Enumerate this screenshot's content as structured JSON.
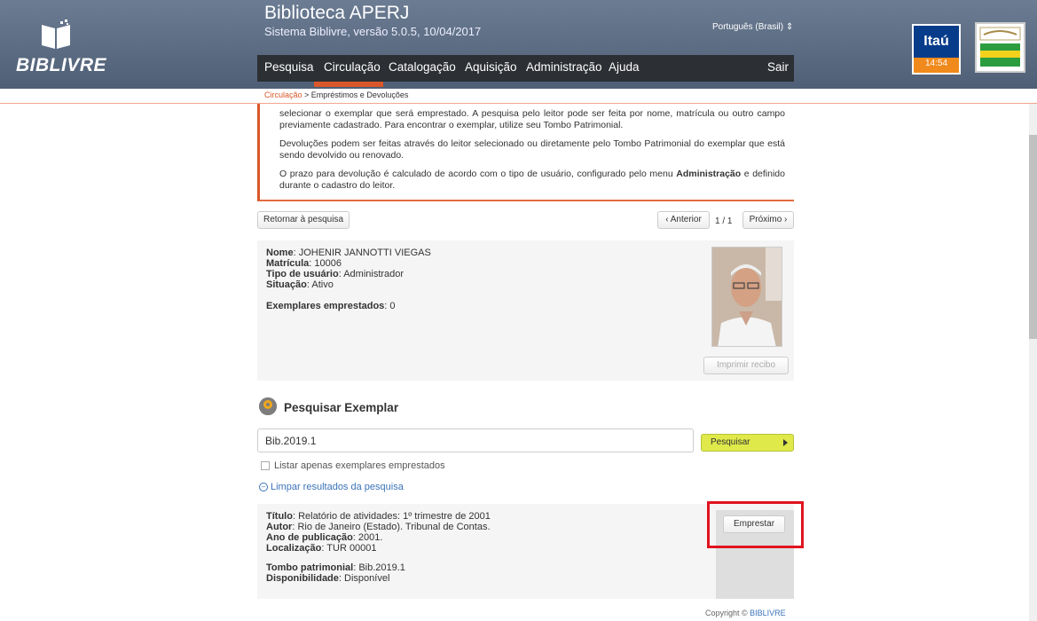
{
  "header": {
    "logo_text": "BIBLIVRE",
    "title": "Biblioteca APERJ",
    "subtitle": "Sistema Biblivre, versão 5.0.5, 10/04/2017",
    "language": "Português (Brasil)",
    "itau_label": "Itaú",
    "itau_time": "14:54",
    "badge_name": "brasil-cultura-badge"
  },
  "menu": {
    "items": [
      "Pesquisa",
      "Circulação",
      "Catalogação",
      "Aquisição",
      "Administração",
      "Ajuda"
    ],
    "logout": "Sair"
  },
  "breadcrumb": {
    "link": "Circulação",
    "separator": " > ",
    "current": "Empréstimos e Devoluções"
  },
  "info": {
    "p1": "selecionar o exemplar que será emprestado. A pesquisa pelo leitor pode ser feita por nome, matrícula ou outro campo previamente cadastrado. Para encontrar o exemplar, utilize seu Tombo Patrimonial.",
    "p2": "Devoluções podem ser feitas através do leitor selecionado ou diretamente pelo Tombo Patrimonial do exemplar que está sendo devolvido ou renovado.",
    "p3_a": "O prazo para devolução é calculado de acordo com o tipo de usuário, configurado pelo menu ",
    "p3_b": "Administração",
    "p3_c": " e definido durante o cadastro do leitor."
  },
  "nav": {
    "back": "Retornar à pesquisa",
    "prev": "‹ Anterior",
    "count": "1 / 1",
    "next": "Próximo ›"
  },
  "user": {
    "nome_label": "Nome",
    "nome": "JOHENIR JANNOTTI VIEGAS",
    "matricula_label": "Matrícula",
    "matricula": "10006",
    "tipo_label": "Tipo de usuário",
    "tipo": "Administrador",
    "situacao_label": "Situação",
    "situacao": "Ativo",
    "emprestados_label": "Exemplares emprestados",
    "emprestados": "0",
    "print_button": "Imprimir recibo"
  },
  "search": {
    "title": "Pesquisar Exemplar",
    "value": "Bib.2019.1",
    "button": "Pesquisar",
    "checkbox_label": "Listar apenas exemplares emprestados",
    "clear_link": "Limpar resultados da pesquisa"
  },
  "result": {
    "titulo_label": "Título",
    "titulo": "Relatório de atividades: 1º trimestre de 2001",
    "autor_label": "Autor",
    "autor": "Rio de Janeiro (Estado). Tribunal de Contas.",
    "ano_label": "Ano de publicação",
    "ano": "2001.",
    "local_label": "Localização",
    "local": "TUR 00001",
    "tombo_label": "Tombo patrimonial",
    "tombo": "Bib.2019.1",
    "disp_label": "Disponibilidade",
    "disp": "Disponível",
    "button": "Emprestar"
  },
  "footer": {
    "copyright": "Copyright © ",
    "brand": "BIBLIVRE"
  },
  "colors": {
    "accent": "#d9572a",
    "header": "#5a6a82",
    "highlight": "#e0141f",
    "search_button": "#dfe94a"
  }
}
